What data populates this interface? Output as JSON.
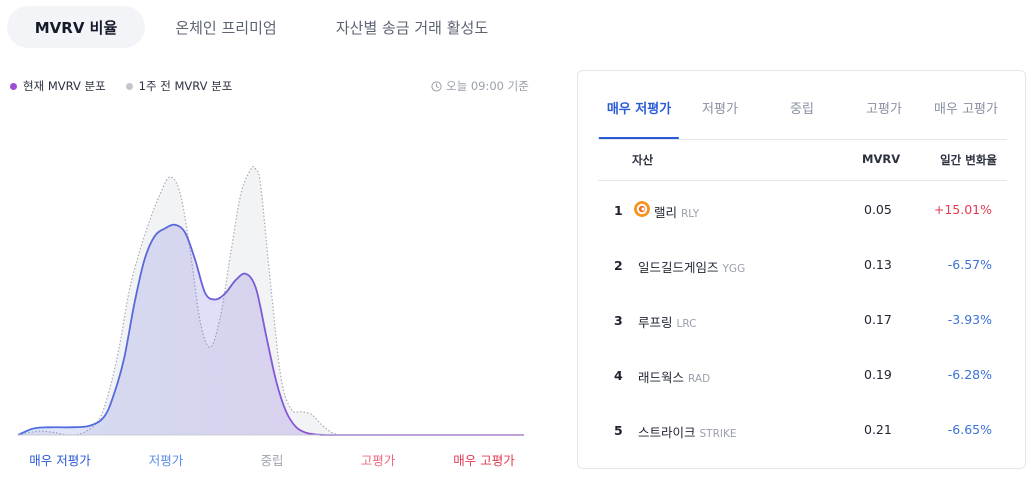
{
  "tabs": [
    {
      "label": "MVRV 비율",
      "active": true
    },
    {
      "label": "온체인 프리미엄",
      "active": false
    },
    {
      "label": "자산별 송금 거래 활성도",
      "active": false
    }
  ],
  "legend": {
    "current": {
      "label": "현재 MVRV 분포",
      "color": "#9b4fd6"
    },
    "previous": {
      "label": "1주 전 MVRV 분포",
      "color": "#c4c6cc"
    }
  },
  "timestamp": {
    "icon": "clock-icon",
    "text": "오늘 09:00 기준"
  },
  "chart_data": {
    "type": "area",
    "x_categories": [
      "매우 저평가",
      "저평가",
      "중립",
      "고평가",
      "매우 고평가"
    ],
    "category_colors": [
      "#2a5bd7",
      "#5b8fe6",
      "#a0a5b0",
      "#ee6b80",
      "#e23c52"
    ],
    "x_range": [
      0,
      100
    ],
    "y_range": [
      0,
      1
    ],
    "series": [
      {
        "name": "현재 MVRV 분포",
        "stroke": "#5b6ed8",
        "style": "solid",
        "x": [
          0,
          3,
          6,
          10,
          14,
          17,
          19,
          21,
          23,
          25,
          27,
          29,
          31,
          33,
          35,
          37,
          39,
          41,
          43,
          45,
          47,
          49,
          51,
          53,
          55,
          57,
          59,
          61,
          63,
          100
        ],
        "y": [
          0,
          0.025,
          0.03,
          0.03,
          0.035,
          0.07,
          0.16,
          0.3,
          0.51,
          0.68,
          0.77,
          0.8,
          0.815,
          0.785,
          0.68,
          0.55,
          0.525,
          0.55,
          0.6,
          0.625,
          0.57,
          0.39,
          0.21,
          0.09,
          0.03,
          0.008,
          0.002,
          0,
          0,
          0
        ]
      },
      {
        "name": "1주 전 MVRV 분포",
        "stroke": "#a8abb2",
        "style": "dotted",
        "x": [
          0,
          4,
          7,
          10,
          13,
          16,
          18,
          20,
          22,
          24,
          26,
          28,
          30,
          32,
          34,
          36,
          38,
          40,
          42,
          44,
          46,
          47,
          48,
          50,
          52,
          54,
          56,
          58,
          60,
          62,
          64,
          67,
          100
        ],
        "y": [
          0,
          0.015,
          0.01,
          0.0,
          0.01,
          0.06,
          0.17,
          0.34,
          0.56,
          0.71,
          0.83,
          0.93,
          1.0,
          0.94,
          0.72,
          0.44,
          0.34,
          0.46,
          0.7,
          0.93,
          1.03,
          1.03,
          0.96,
          0.57,
          0.22,
          0.1,
          0.09,
          0.08,
          0.04,
          0.01,
          0,
          0,
          0
        ]
      }
    ]
  },
  "panel": {
    "tabs": [
      {
        "label": "매우 저평가",
        "active": true
      },
      {
        "label": "저평가",
        "active": false
      },
      {
        "label": "중립",
        "active": false
      },
      {
        "label": "고평가",
        "active": false
      },
      {
        "label": "매우 고평가",
        "active": false
      }
    ],
    "headers": {
      "asset": "자산",
      "mvrv": "MVRV",
      "change": "일간 변화율"
    },
    "rows": [
      {
        "rank": "1",
        "name": "랠리",
        "symbol": "RLY",
        "mvrv": "0.05",
        "change": "+15.01%",
        "direction": "up",
        "icon": "rally-coin-icon"
      },
      {
        "rank": "2",
        "name": "일드길드게임즈",
        "symbol": "YGG",
        "mvrv": "0.13",
        "change": "-6.57%",
        "direction": "down"
      },
      {
        "rank": "3",
        "name": "루프링",
        "symbol": "LRC",
        "mvrv": "0.17",
        "change": "-3.93%",
        "direction": "down"
      },
      {
        "rank": "4",
        "name": "래드웍스",
        "symbol": "RAD",
        "mvrv": "0.19",
        "change": "-6.28%",
        "direction": "down"
      },
      {
        "rank": "5",
        "name": "스트라이크",
        "symbol": "STRIKE",
        "mvrv": "0.21",
        "change": "-6.65%",
        "direction": "down"
      }
    ]
  }
}
